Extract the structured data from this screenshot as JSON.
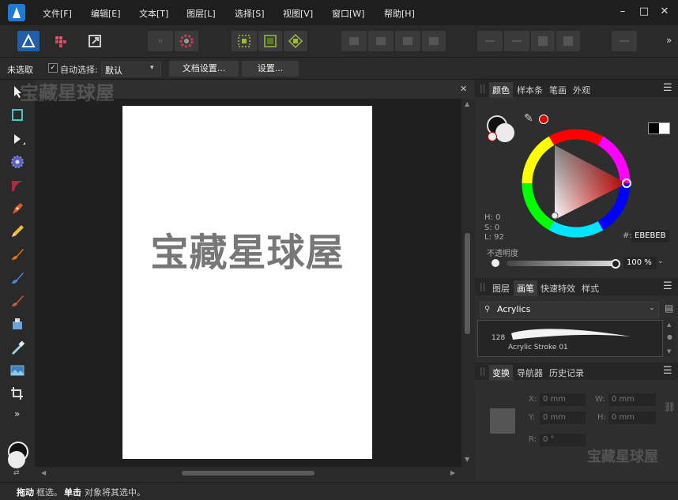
{
  "menubar": {
    "items": [
      "文件[F]",
      "编辑[E]",
      "文本[T]",
      "图层[L]",
      "选择[S]",
      "视图[V]",
      "窗口[W]",
      "帮助[H]"
    ],
    "minimize": "–",
    "maximize": "□",
    "close": "✕"
  },
  "toolbar": {
    "more": "»"
  },
  "context_bar": {
    "selection_status": "未选取",
    "auto_select_label": "自动选择:",
    "auto_select_value": "默认",
    "doc_settings_label": "文档设置...",
    "settings_label": "设置..."
  },
  "canvas": {
    "close": "✕",
    "document_text": "宝藏星球屋"
  },
  "tools_more": "»",
  "color_panel": {
    "tabs": [
      "颜色",
      "样本条",
      "笔画",
      "外观"
    ],
    "h_label": "H: 0",
    "s_label": "S: 0",
    "l_label": "L: 92",
    "hex_prefix": "#:",
    "hex_value": "EBEBEB",
    "opacity_label": "不透明度",
    "opacity_value": "100 %",
    "colors": {
      "fill": "#ebebeb",
      "accent": "#e60000"
    }
  },
  "brush_panel": {
    "tabs": [
      "图层",
      "画笔",
      "快速特效",
      "样式"
    ],
    "category": "Acrylics",
    "brush_size": "128",
    "brush_name": "Acrylic Stroke 01"
  },
  "transform_panel": {
    "tabs": [
      "变换",
      "导航器",
      "历史记录"
    ],
    "x_label": "X:",
    "x_value": "0 mm",
    "y_label": "Y:",
    "y_value": "0 mm",
    "w_label": "W:",
    "w_value": "0 mm",
    "h_label": "H:",
    "h_value": "0 mm",
    "r_label": "R:",
    "r_value": "0 °"
  },
  "statusbar": {
    "drag_bold": "拖动",
    "drag_text": "框选。",
    "click_bold": "单击",
    "click_text": "对象将其选中。"
  },
  "watermark": {
    "text": "宝藏星球屋"
  }
}
